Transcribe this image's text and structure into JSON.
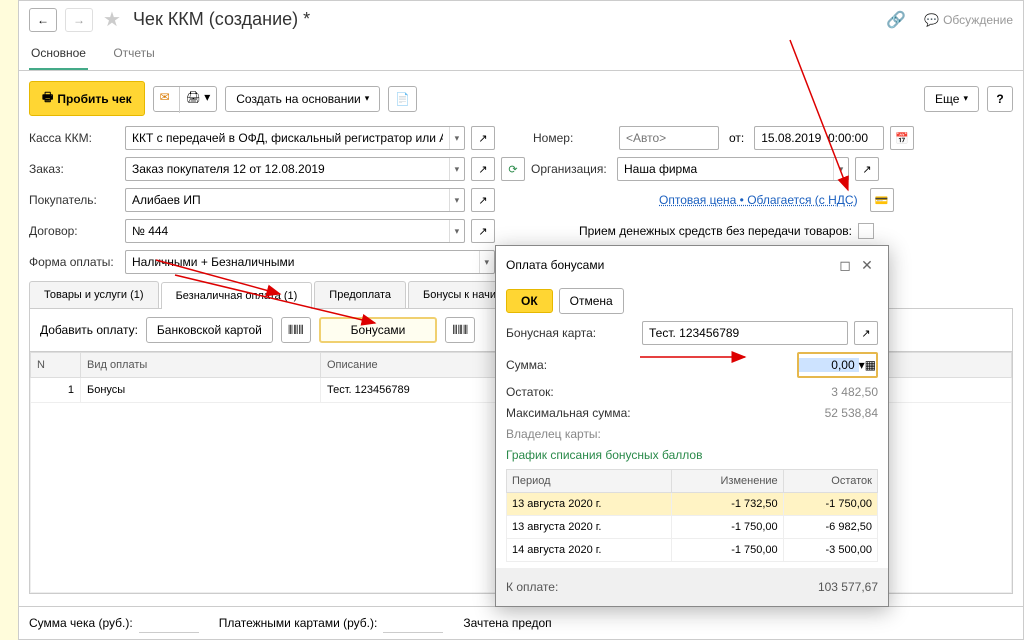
{
  "header": {
    "title": "Чек ККМ (создание) *",
    "discuss": "Обсуждение"
  },
  "nav": {
    "main_tab": "Основное",
    "reports_tab": "Отчеты"
  },
  "toolbar": {
    "punch": "Пробить чек",
    "create_based": "Создать на основании",
    "more": "Еще"
  },
  "form": {
    "kassa_lbl": "Касса ККМ:",
    "kassa_val": "ККТ с передачей в ОФД, фискальный регистратор или АСП",
    "order_lbl": "Заказ:",
    "order_val": "Заказ покупателя 12 от 12.08.2019",
    "buyer_lbl": "Покупатель:",
    "buyer_val": "Алибаев ИП",
    "contract_lbl": "Договор:",
    "contract_val": "№ 444",
    "payform_lbl": "Форма оплаты:",
    "payform_val": "Наличными + Безналичными",
    "number_lbl": "Номер:",
    "number_ph": "<Авто>",
    "from_lbl": "от:",
    "date_val": "15.08.2019  0:00:00",
    "org_lbl": "Организация:",
    "org_val": "Наша фирма",
    "price_link": "Оптовая цена • Облагается (с НДС)",
    "accept_lbl": "Прием денежных средств без передачи товаров:"
  },
  "tabs2": {
    "t1": "Товары и услуги (1)",
    "t2": "Безналичная оплата (1)",
    "t3": "Предоплата",
    "t4": "Бонусы к начисле"
  },
  "sub": {
    "add_pay": "Добавить оплату:",
    "bank": "Банковской картой",
    "bonus": "Бонусами"
  },
  "table": {
    "h_n": "N",
    "h_type": "Вид оплаты",
    "h_desc": "Описание",
    "rows": [
      {
        "n": "1",
        "type": "Бонусы",
        "desc": "Тест. 123456789"
      }
    ]
  },
  "footer": {
    "sum": "Сумма чека (руб.):",
    "cards": "Платежными картами (руб.):",
    "prepay": "Зачтена предоп"
  },
  "modal": {
    "title": "Оплата бонусами",
    "ok": "ОК",
    "cancel": "Отмена",
    "card_lbl": "Бонусная карта:",
    "card_val": "Тест. 123456789",
    "sum_lbl": "Сумма:",
    "sum_val": "0,00",
    "balance_lbl": "Остаток:",
    "balance_val": "3 482,50",
    "max_lbl": "Максимальная сумма:",
    "max_val": "52 538,84",
    "owner_lbl": "Владелец карты:",
    "schedule": "График списания бонусных баллов",
    "h_period": "Период",
    "h_change": "Изменение",
    "h_rest": "Остаток",
    "rows": [
      {
        "p": "13 августа 2020 г.",
        "c": "-1 732,50",
        "r": "-1 750,00"
      },
      {
        "p": "13 августа 2020 г.",
        "c": "-1 750,00",
        "r": "-6 982,50"
      },
      {
        "p": "14 августа 2020 г.",
        "c": "-1 750,00",
        "r": "-3 500,00"
      }
    ],
    "topay_lbl": "К оплате:",
    "topay_val": "103 577,67"
  }
}
